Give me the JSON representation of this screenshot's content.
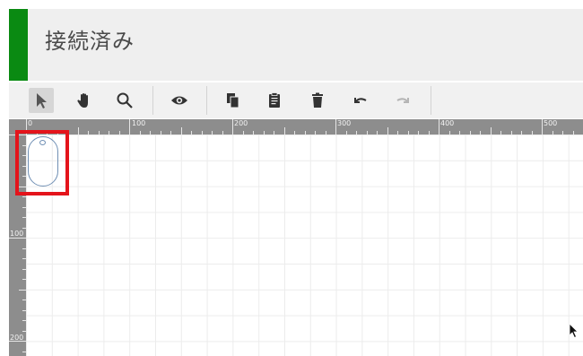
{
  "status": {
    "text": "接続済み",
    "indicator_color": "#0a8a12"
  },
  "toolbar": {
    "tools": [
      {
        "name": "select-tool",
        "icon": "arrow-pointer-icon",
        "state": "active"
      },
      {
        "name": "pan-tool",
        "icon": "hand-icon",
        "state": "normal"
      },
      {
        "name": "zoom-tool",
        "icon": "magnifier-icon",
        "state": "normal"
      },
      {
        "name": "preview-tool",
        "icon": "eye-icon",
        "state": "normal"
      },
      {
        "name": "copy-tool",
        "icon": "copy-icon",
        "state": "normal"
      },
      {
        "name": "paste-tool",
        "icon": "clipboard-icon",
        "state": "normal"
      },
      {
        "name": "delete-tool",
        "icon": "trash-icon",
        "state": "normal"
      },
      {
        "name": "undo-tool",
        "icon": "undo-icon",
        "state": "normal"
      },
      {
        "name": "redo-tool",
        "icon": "redo-icon",
        "state": "disabled"
      }
    ]
  },
  "ruler": {
    "top_labels": [
      "0",
      "100",
      "200",
      "300",
      "400",
      "500"
    ],
    "left_labels": [
      "100",
      "200"
    ]
  },
  "colors": {
    "highlight": "#e4141b",
    "shape_outline": "#6f8fb4"
  }
}
